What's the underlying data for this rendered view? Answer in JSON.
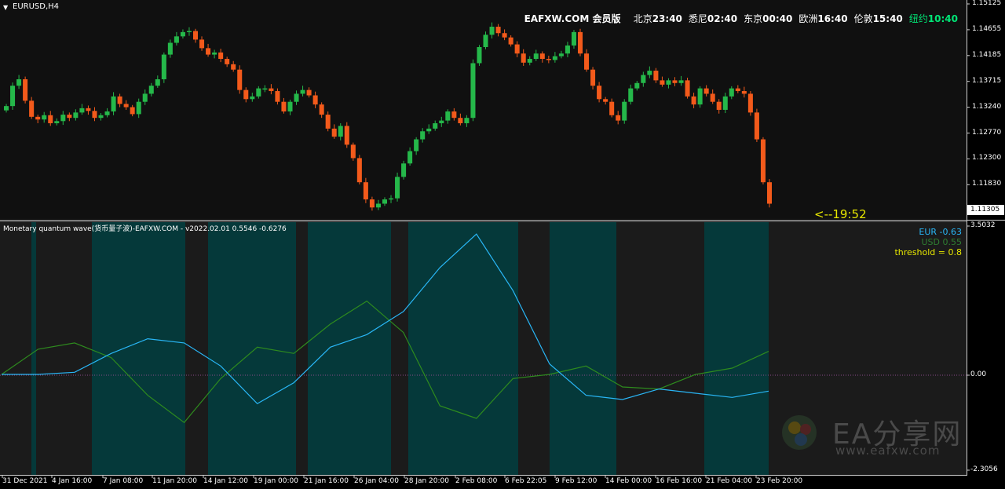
{
  "symbol_label": "EURUSD,H4",
  "header": {
    "brand": "EAFXW.COM 会员版",
    "sessions": [
      {
        "city": "北京",
        "time": "23:40",
        "color": "#ffffff"
      },
      {
        "city": "悉尼",
        "time": "02:40",
        "color": "#ffffff"
      },
      {
        "city": "东京",
        "time": "00:40",
        "color": "#ffffff"
      },
      {
        "city": "欧洲",
        "time": "16:40",
        "color": "#ffffff"
      },
      {
        "city": "伦敦",
        "time": "15:40",
        "color": "#ffffff"
      },
      {
        "city": "纽约",
        "time": "10:40",
        "color": "#00e676"
      }
    ]
  },
  "countdown": "<--19:52",
  "price_axis": {
    "labels": [
      "1.15125",
      "1.14655",
      "1.14185",
      "1.13715",
      "1.13240",
      "1.12770",
      "1.12300",
      "1.11830"
    ],
    "current_price": "1.11305"
  },
  "indicator": {
    "title": "Monetary quantum wave(货币量子波)-EAFXW.COM - v2022.02.01 0.5546 -0.6276",
    "legend": [
      {
        "text": "EUR -0.63",
        "color": "#29b6f6"
      },
      {
        "text": "USD 0.55",
        "color": "#2e7d32"
      },
      {
        "text": "threshold = 0.8",
        "color": "#e6e600"
      }
    ],
    "axis_labels": [
      "3.5032",
      "0.00",
      "-2.3056"
    ]
  },
  "time_axis": [
    "31 Dec 2021",
    "4 Jan 16:00",
    "7 Jan 08:00",
    "11 Jan 20:00",
    "14 Jan 12:00",
    "19 Jan 00:00",
    "21 Jan 16:00",
    "26 Jan 04:00",
    "28 Jan 20:00",
    "2 Feb 08:00",
    "6 Feb 22:05",
    "9 Feb 12:00",
    "14 Feb 00:00",
    "16 Feb 16:00",
    "21 Feb 04:00",
    "23 Feb 20:00"
  ],
  "watermark": {
    "brand": "EA分享网",
    "url": "www.eafxw.com"
  },
  "colors": {
    "bull": "#25b84a",
    "bear": "#f35a1b",
    "eur_line": "#29b6f6",
    "usd_line": "#2e8b1e",
    "shade": "#05393a",
    "zero_line": "#8a4a8a"
  },
  "chart_data": [
    {
      "type": "line",
      "name": "EURUSD H4 close (approx.)",
      "y": [
        1.1322,
        1.136,
        1.1372,
        1.1332,
        1.1302,
        1.1297,
        1.1305,
        1.129,
        1.1294,
        1.1306,
        1.13,
        1.131,
        1.1318,
        1.1313,
        1.13,
        1.1305,
        1.1312,
        1.134,
        1.1326,
        1.132,
        1.1307,
        1.133,
        1.1345,
        1.136,
        1.1372,
        1.1418,
        1.144,
        1.1452,
        1.146,
        1.1462,
        1.1446,
        1.143,
        1.1418,
        1.1422,
        1.141,
        1.14,
        1.139,
        1.1352,
        1.1335,
        1.134,
        1.1355,
        1.1355,
        1.135,
        1.133,
        1.1312,
        1.133,
        1.1345,
        1.1352,
        1.1342,
        1.1325,
        1.1306,
        1.128,
        1.1265,
        1.1285,
        1.125,
        1.1225,
        1.118,
        1.1148,
        1.1133,
        1.114,
        1.1148,
        1.115,
        1.119,
        1.1215,
        1.1238,
        1.126,
        1.1275,
        1.128,
        1.129,
        1.1295,
        1.1312,
        1.13,
        1.129,
        1.13,
        1.1402,
        1.1432,
        1.1455,
        1.147,
        1.1458,
        1.145,
        1.1437,
        1.142,
        1.1403,
        1.141,
        1.142,
        1.141,
        1.1408,
        1.1415,
        1.142,
        1.1435,
        1.146,
        1.142,
        1.139,
        1.136,
        1.1335,
        1.133,
        1.1305,
        1.1295,
        1.133,
        1.1355,
        1.1365,
        1.138,
        1.1388,
        1.137,
        1.1362,
        1.137,
        1.1365,
        1.137,
        1.134,
        1.1325,
        1.1355,
        1.1345,
        1.133,
        1.1315,
        1.134,
        1.1355,
        1.135,
        1.1345,
        1.131,
        1.126,
        1.118,
        1.114
      ]
    },
    {
      "type": "line",
      "name": "Monetary quantum wave",
      "series": [
        {
          "name": "EUR",
          "values": [
            0.0,
            0.0,
            0.05,
            0.5,
            0.85,
            0.75,
            0.2,
            -0.7,
            -0.2,
            0.65,
            0.95,
            1.5,
            2.55,
            3.35,
            2.0,
            0.25,
            -0.5,
            -0.6,
            -0.35,
            -0.45,
            -0.55,
            -0.4
          ]
        },
        {
          "name": "USD",
          "values": [
            0.0,
            0.6,
            0.75,
            0.4,
            -0.5,
            -1.15,
            -0.1,
            0.65,
            0.5,
            1.2,
            1.75,
            1.0,
            -0.75,
            -1.05,
            -0.1,
            0.0,
            0.2,
            -0.3,
            -0.35,
            0.0,
            0.15,
            0.55
          ]
        }
      ],
      "ylim": [
        -2.3056,
        3.5032
      ],
      "threshold": 0.8
    }
  ]
}
